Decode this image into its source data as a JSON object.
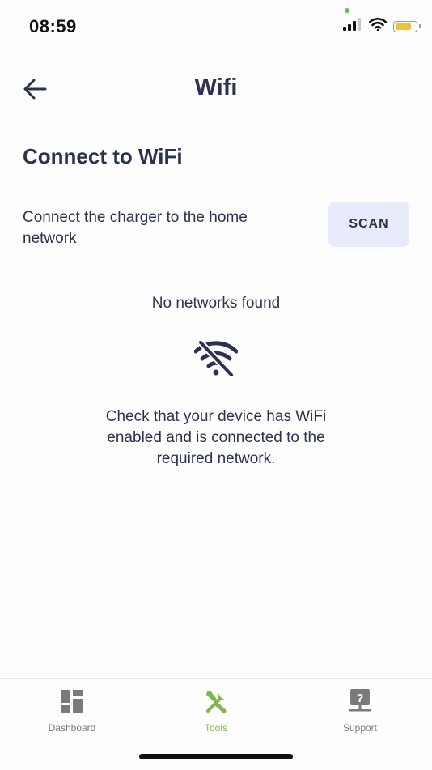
{
  "status_bar": {
    "time": "08:59"
  },
  "header": {
    "title": "Wifi",
    "back_icon": "arrow-left-icon"
  },
  "content": {
    "heading": "Connect to WiFi",
    "description": "Connect the charger to the home network",
    "scan_label": "SCAN",
    "no_networks_text": "No networks found",
    "empty_icon": "wifi-off-icon",
    "hint_text": "Check that your device has WiFi enabled and is connected to the required network."
  },
  "bottom_nav": {
    "items": [
      {
        "label": "Dashboard",
        "icon": "dashboard-icon",
        "active": false
      },
      {
        "label": "Tools",
        "icon": "tools-icon",
        "active": true
      },
      {
        "label": "Support",
        "icon": "support-icon",
        "active": false
      }
    ]
  },
  "colors": {
    "text_primary": "#2b3250",
    "scan_bg": "#e8ecfa",
    "accent_active": "#7cb84a",
    "nav_inactive": "#7a7a7a",
    "battery": "#f2c230"
  }
}
